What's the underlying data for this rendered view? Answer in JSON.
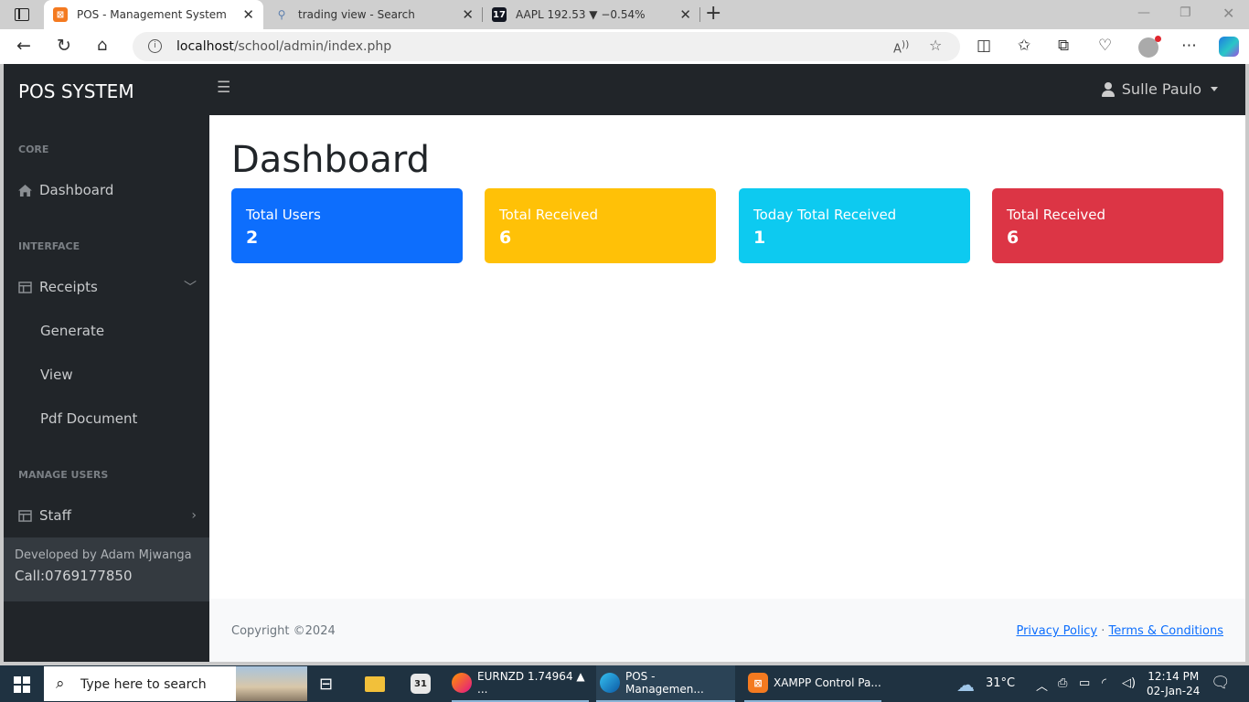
{
  "browser": {
    "tabs": [
      {
        "title": "POS - Management System",
        "active": true
      },
      {
        "title": "trading view - Search",
        "active": false
      },
      {
        "title": "AAPL 192.53 ▼ −0.54%",
        "active": false
      }
    ],
    "url_host": "localhost",
    "url_path": "/school/admin/index.php"
  },
  "app": {
    "brand": "POS SYSTEM",
    "user_name": "Sulle Paulo",
    "sidebar": {
      "core_heading": "CORE",
      "dashboard": "Dashboard",
      "interface_heading": "INTERFACE",
      "receipts": "Receipts",
      "receipts_sub": [
        "Generate",
        "View",
        "Pdf Document"
      ],
      "manage_users_heading": "MANAGE USERS",
      "staff": "Staff",
      "footer_line1": "Developed by Adam Mjwanga",
      "footer_line2": "Call:0769177850"
    },
    "page_title": "Dashboard",
    "cards": [
      {
        "label": "Total Users",
        "value": "2",
        "color": "#0d6efd",
        "text_color": "#ffffff"
      },
      {
        "label": "Total Received",
        "value": "6",
        "color": "#ffc107",
        "text_color": "#ffffff"
      },
      {
        "label": "Today Total Received",
        "value": "1",
        "color": "#0dcaf0",
        "text_color": "#ffffff"
      },
      {
        "label": "Total Received",
        "value": "6",
        "color": "#dc3545",
        "text_color": "#ffffff"
      }
    ],
    "footer": {
      "copyright": "Copyright ©2024",
      "privacy": "Privacy Policy",
      "separator": "·",
      "terms": "Terms & Conditions"
    }
  },
  "taskbar": {
    "search_placeholder": "Type here to search",
    "apps": [
      {
        "label": "EURNZD 1.74964 ▲ ..."
      },
      {
        "label": "POS - Managemen..."
      },
      {
        "label": "XAMPP Control Pa..."
      }
    ],
    "weather": "31°C",
    "time": "12:14 PM",
    "date": "02-Jan-24"
  }
}
